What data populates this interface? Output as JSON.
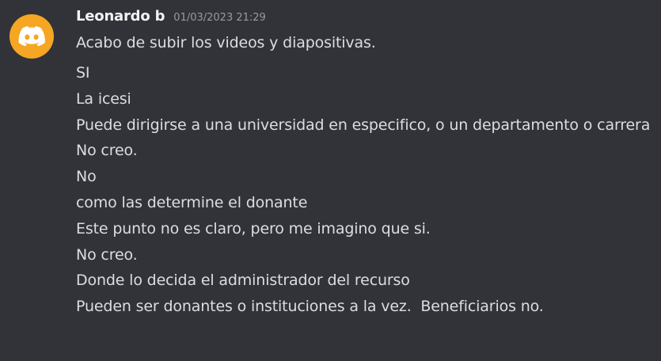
{
  "message": {
    "author": "Leonardo b",
    "timestamp": "01/03/2023 21:29",
    "avatar_icon": "discord-logo-icon",
    "avatar_color": "#f5a623",
    "lines": [
      "Acabo de subir los videos y diapositivas.",
      "SI",
      "La icesi",
      "Puede dirigirse a una universidad en especifico, o un departamento o carrera",
      "No creo.",
      "No",
      "como las determine el donante",
      "Este punto no es claro, pero me imagino que si.",
      "No creo.",
      "Donde lo decida el administrador del recurso",
      "Pueden ser donantes o instituciones a la vez.  Beneficiarios no."
    ]
  }
}
